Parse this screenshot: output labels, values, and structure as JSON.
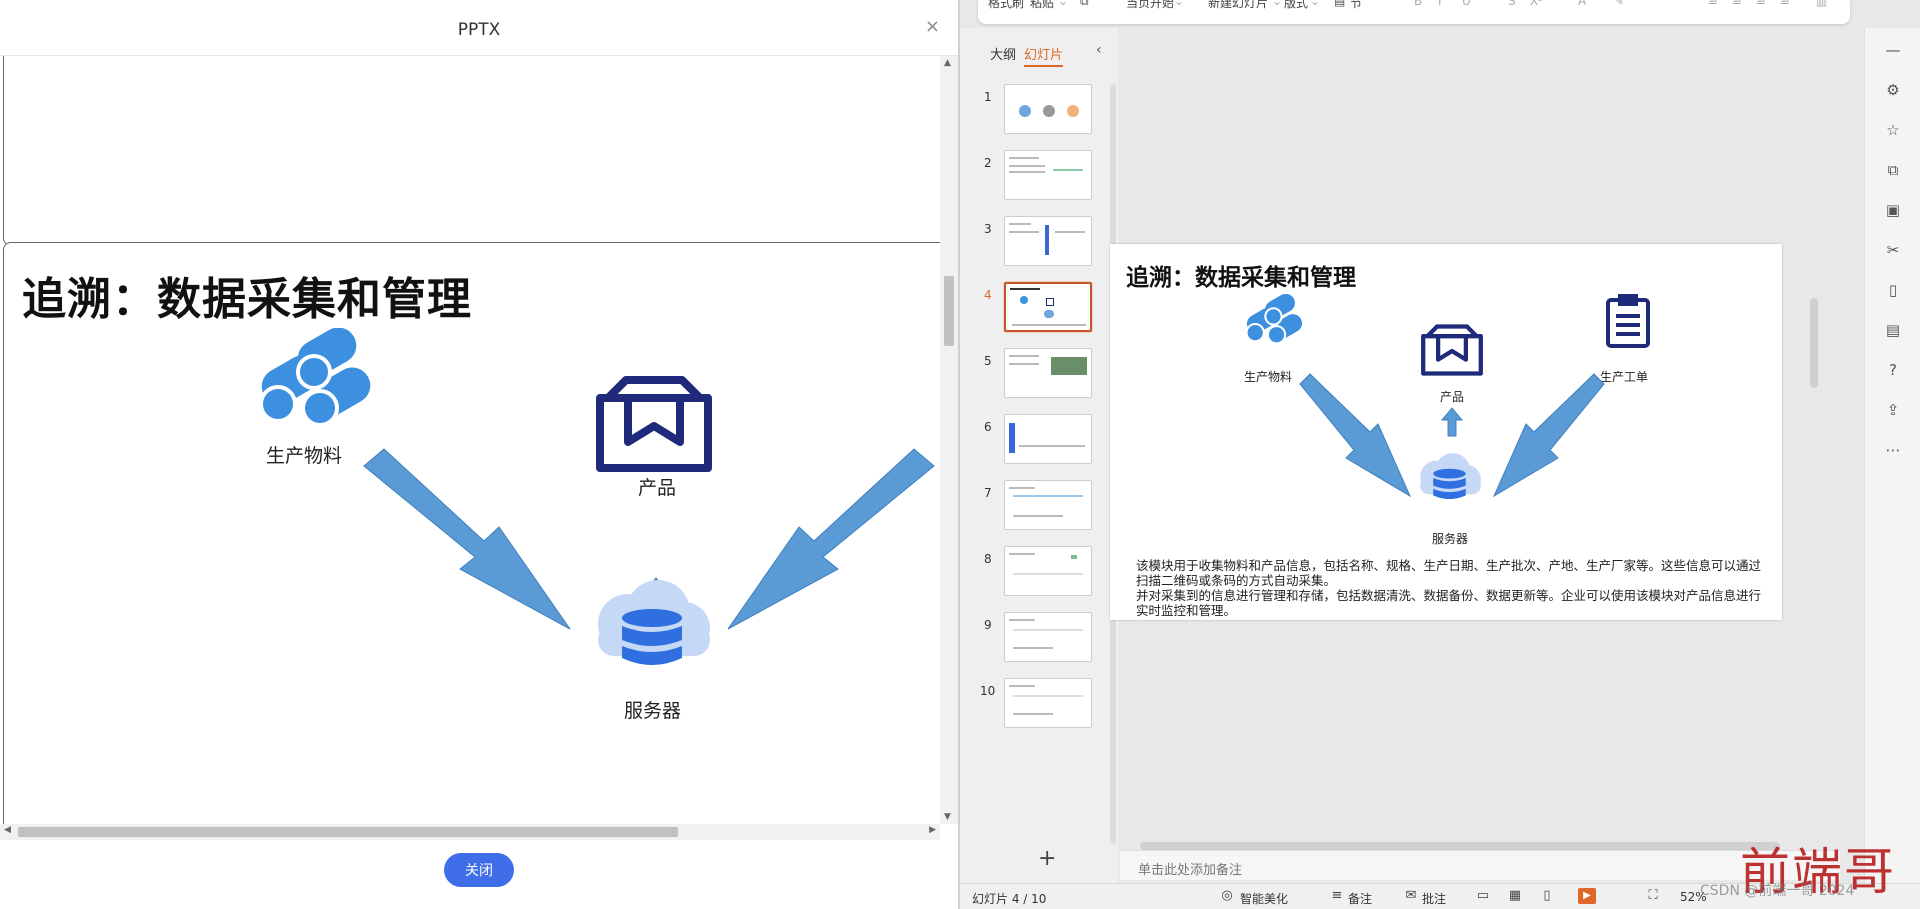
{
  "left": {
    "title": "PPTX",
    "close_icon": "×",
    "slide": {
      "title": "追溯：数据采集和管理",
      "labels": {
        "materials": "生产物料",
        "product": "产品",
        "server": "服务器"
      }
    },
    "close_button": "关闭"
  },
  "ribbon": {
    "format_painter": "格式刷",
    "paste": "粘贴",
    "start_from_current": "当页开始",
    "new_slide": "新建幻灯片",
    "layout": "版式",
    "section": "节",
    "bold": "B",
    "italic": "I",
    "underline": "U",
    "strike": "S",
    "superscript": "X²"
  },
  "right": {
    "tabs": {
      "outline": "大纲",
      "slides": "幻灯片"
    },
    "collapse_icon": "‹",
    "thumbnails": [
      {
        "num": "1",
        "active": false
      },
      {
        "num": "2",
        "active": false
      },
      {
        "num": "3",
        "active": false
      },
      {
        "num": "4",
        "active": true
      },
      {
        "num": "5",
        "active": false
      },
      {
        "num": "6",
        "active": false
      },
      {
        "num": "7",
        "active": false
      },
      {
        "num": "8",
        "active": false
      },
      {
        "num": "9",
        "active": false
      },
      {
        "num": "10",
        "active": false
      }
    ],
    "add_slide": "+",
    "slide": {
      "title": "追溯：数据采集和管理",
      "labels": {
        "materials": "生产物料",
        "product": "产品",
        "order": "生产工单",
        "server": "服务器"
      },
      "desc_line1": "该模块用于收集物料和产品信息，包括名称、规格、生产日期、生产批次、产地、生产厂家等。这些信息可以通过扫描二维码或条码的方式自动采集。",
      "desc_line2": "并对采集到的信息进行管理和存储，包括数据清洗、数据备份、数据更新等。企业可以使用该模块对产品信息进行实时监控和管理。"
    },
    "notes_placeholder": "单击此处添加备注",
    "status": {
      "slide_counter": "幻灯片 4 / 10",
      "smart_beautify": "智能美化",
      "notes": "备注",
      "comments": "批注",
      "zoom": "52%"
    }
  },
  "watermark": {
    "text": "前端哥",
    "sub": "CSDN @前端一哥 2024"
  },
  "colors": {
    "accent_orange": "#d96a26",
    "button_blue": "#3f6ee8",
    "icon_navy": "#1f2a7a",
    "icon_blue": "#3d7de0",
    "arrow_blue": "#5b9bd5",
    "watermark_red": "#b81c1c"
  }
}
